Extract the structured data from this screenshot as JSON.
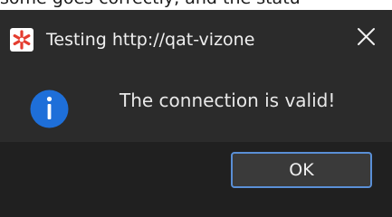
{
  "background_text": {
    "partial": "some goes correctly, and the statu"
  },
  "dialog": {
    "title": "Testing http://qat-vizone",
    "app_icon": "asterisk-app-icon",
    "close_icon": "close-icon",
    "info_icon": "info-icon",
    "message": "The connection is valid!",
    "ok_label": "OK"
  },
  "colors": {
    "title_bar": "#2b2b2b",
    "content": "#2b2b2b",
    "footer": "#202020",
    "accent": "#1e6fd9",
    "button_border": "#5a8fd6",
    "app_icon": "#e43c2f"
  }
}
